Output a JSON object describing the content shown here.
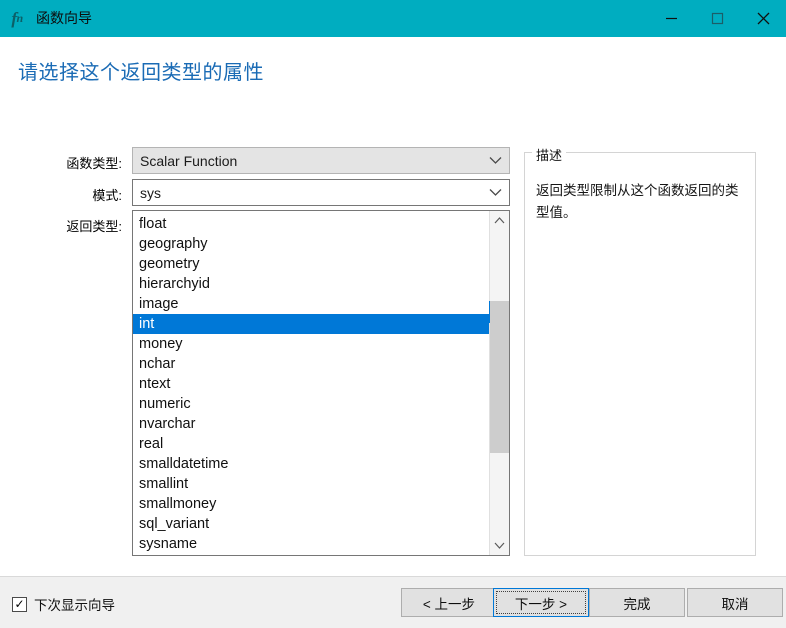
{
  "window": {
    "title": "函数向导",
    "icon": "function-fx-icon",
    "titlebar_color": "#00adc0",
    "controls": [
      {
        "name": "minimize",
        "glyph": "—"
      },
      {
        "name": "maximize",
        "glyph": "□"
      },
      {
        "name": "close",
        "glyph": "✕"
      }
    ]
  },
  "heading": "请选择这个返回类型的属性",
  "accent_colors": {
    "heading": "#1a6bb5",
    "selection": "#0078d7",
    "titlebar": "#00adc0"
  },
  "form": {
    "function_type": {
      "label": "函数类型:",
      "value": "Scalar Function",
      "disabled": true
    },
    "schema": {
      "label": "模式:",
      "value": "sys",
      "disabled": false
    },
    "return_type": {
      "label": "返回类型:",
      "selected": "int",
      "items": [
        "float",
        "geography",
        "geometry",
        "hierarchyid",
        "image",
        "int",
        "money",
        "nchar",
        "ntext",
        "numeric",
        "nvarchar",
        "real",
        "smalldatetime",
        "smallint",
        "smallmoney",
        "sql_variant",
        "sysname"
      ]
    }
  },
  "description": {
    "legend": "描述",
    "text": "返回类型限制从这个函数返回的类型值。"
  },
  "footer": {
    "checkbox": {
      "label": "下次显示向导",
      "checked": true,
      "glyph": "✓"
    },
    "buttons": [
      {
        "name": "back",
        "label": "< 上一步",
        "focused": false
      },
      {
        "name": "next",
        "label": "下一步 >",
        "focused": true
      },
      {
        "name": "finish",
        "label": "完成",
        "focused": false
      },
      {
        "name": "cancel",
        "label": "取消",
        "focused": false
      }
    ]
  }
}
